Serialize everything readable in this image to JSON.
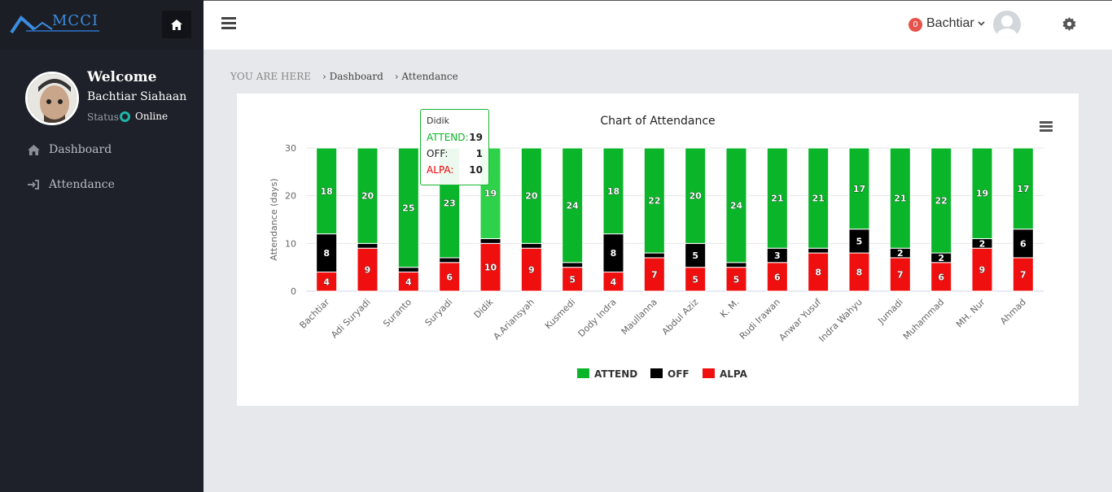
{
  "brand": {
    "name": "MCCI"
  },
  "sidebar": {
    "welcome": "Welcome",
    "user_name": "Bachtiar Siahaan",
    "status_label": "Status",
    "status_value": "Online",
    "items": [
      {
        "label": "Dashboard",
        "icon": "home-icon"
      },
      {
        "label": "Attendance",
        "icon": "sign-in-icon"
      }
    ]
  },
  "topbar": {
    "notification_count": "0",
    "user": "Bachtiar"
  },
  "breadcrumb": {
    "prefix": "YOU ARE HERE",
    "items": [
      "Dashboard",
      "Attendance"
    ]
  },
  "colors": {
    "attend": "#0ab52a",
    "off": "#000000",
    "alpa": "#f00f0f"
  },
  "chart_data": {
    "type": "bar",
    "stacked": true,
    "title": "Chart of Attendance",
    "ylabel": "Attendance (days)",
    "ylim": [
      0,
      30
    ],
    "yticks": [
      0,
      10,
      20,
      30
    ],
    "categories": [
      "Bachtiar",
      "Adi Suryadi",
      "Suranto",
      "Suryadi",
      "Didik",
      "A.Ariansyah",
      "Kusmedi",
      "Dody Indra",
      "Maullanna",
      "Abdul Aziz",
      "K. M.",
      "Rudi Irawan",
      "Anwar Yusuf",
      "Indra Wahyu",
      "Jumadi",
      "Muhammad",
      "MH. Nur",
      "Ahmad"
    ],
    "series": [
      {
        "name": "ATTEND",
        "values": [
          18,
          20,
          25,
          23,
          19,
          20,
          24,
          18,
          22,
          20,
          24,
          21,
          21,
          17,
          21,
          22,
          19,
          17
        ]
      },
      {
        "name": "OFF",
        "values": [
          8,
          1,
          1,
          1,
          1,
          1,
          1,
          8,
          1,
          5,
          1,
          3,
          1,
          5,
          2,
          2,
          2,
          6
        ]
      },
      {
        "name": "ALPA",
        "values": [
          4,
          9,
          4,
          6,
          10,
          9,
          5,
          4,
          7,
          5,
          5,
          6,
          8,
          8,
          7,
          6,
          9,
          7
        ]
      }
    ],
    "legend_position": "bottom",
    "tooltip": {
      "category": "Didik",
      "ATTEND": 19,
      "OFF": 1,
      "ALPA": 10
    }
  }
}
